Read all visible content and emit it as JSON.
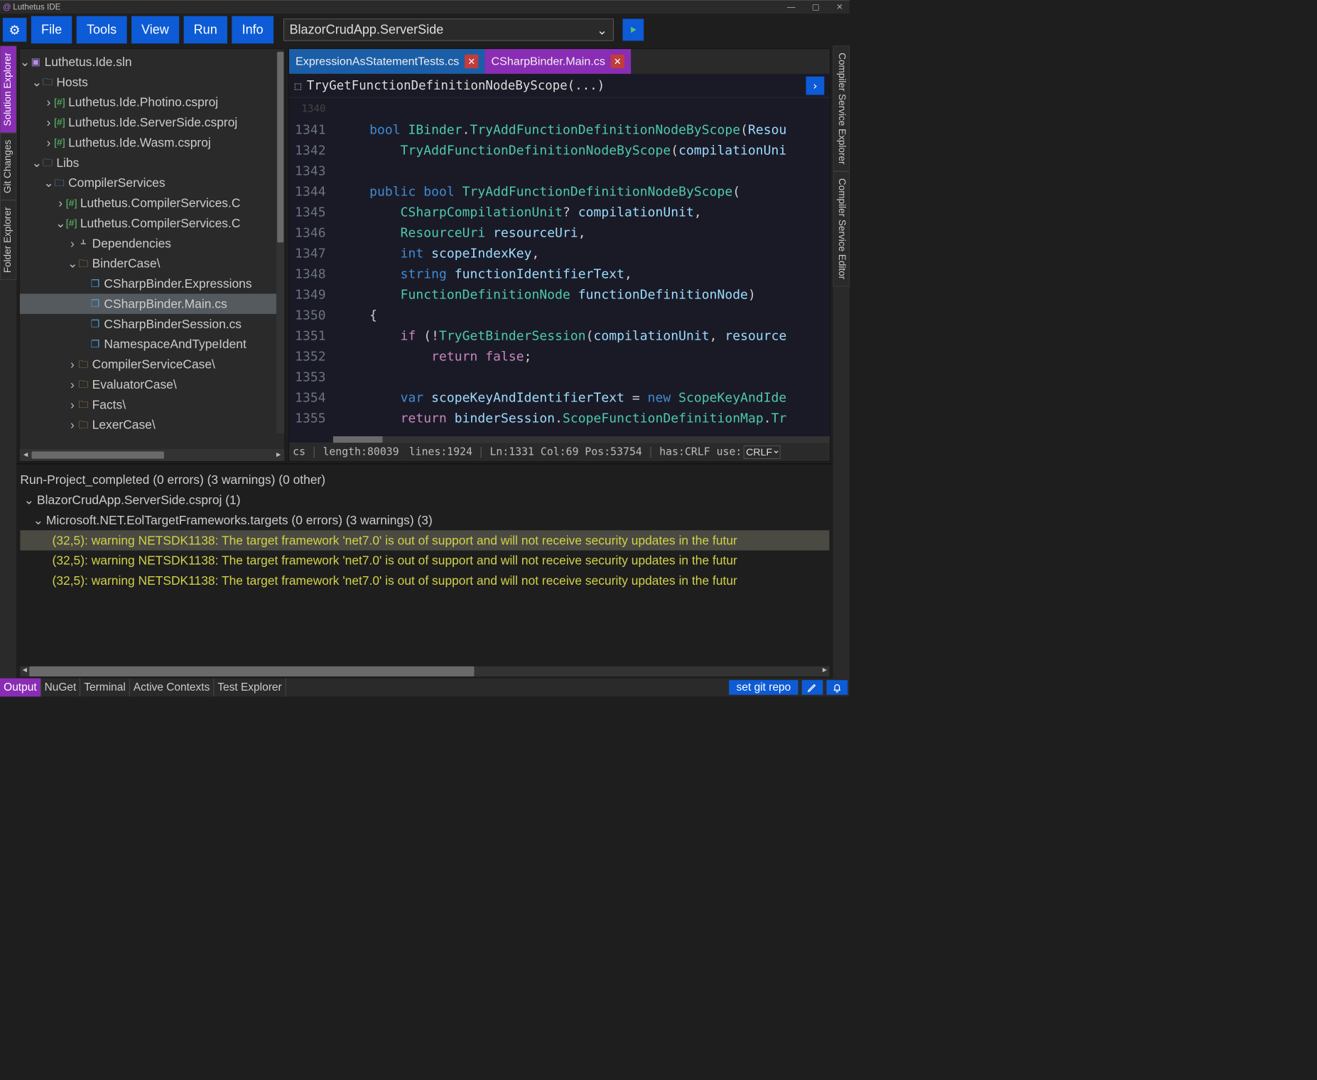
{
  "window": {
    "title": "Luthetus IDE"
  },
  "menu": {
    "items": [
      "File",
      "Tools",
      "View",
      "Run",
      "Info"
    ],
    "project_selected": "BlazorCrudApp.ServerSide"
  },
  "left_rail": [
    {
      "label": "Solution Explorer",
      "active": true
    },
    {
      "label": "Git Changes",
      "active": false
    },
    {
      "label": "Folder Explorer",
      "active": false
    }
  ],
  "right_rail": [
    {
      "label": "Compiler Service Explorer",
      "active": false
    },
    {
      "label": "Compiler Service Editor",
      "active": false
    }
  ],
  "tree": {
    "root": "Luthetus.Ide.sln",
    "hosts_label": "Hosts",
    "hosts": [
      "Luthetus.Ide.Photino.csproj",
      "Luthetus.Ide.ServerSide.csproj",
      "Luthetus.Ide.Wasm.csproj"
    ],
    "libs_label": "Libs",
    "compiler_services": "CompilerServices",
    "cs_proj_a": "Luthetus.CompilerServices.C",
    "cs_proj_b": "Luthetus.CompilerServices.C",
    "deps": "Dependencies",
    "binder_case": "BinderCase\\",
    "files": [
      "CSharpBinder.Expressions",
      "CSharpBinder.Main.cs",
      "CSharpBinderSession.cs",
      "NamespaceAndTypeIdent"
    ],
    "folders": [
      "CompilerServiceCase\\",
      "EvaluatorCase\\",
      "Facts\\",
      "LexerCase\\"
    ]
  },
  "editor": {
    "tabs": [
      {
        "label": "ExpressionAsStatementTests.cs",
        "active": false
      },
      {
        "label": "CSharpBinder.Main.cs",
        "active": true
      }
    ],
    "breadcrumb": "TryGetFunctionDefinitionNodeByScope(...)",
    "first_line": 1340,
    "lines": [
      "",
      "    bool IBinder.TryAddFunctionDefinitionNodeByScope(Resou",
      "        TryAddFunctionDefinitionNodeByScope(compilationUni",
      "",
      "    public bool TryAddFunctionDefinitionNodeByScope(",
      "        CSharpCompilationUnit? compilationUnit,",
      "        ResourceUri resourceUri,",
      "        int scopeIndexKey,",
      "        string functionIdentifierText,",
      "        FunctionDefinitionNode functionDefinitionNode)",
      "    {",
      "        if (!TryGetBinderSession(compilationUnit, resource",
      "            return false;",
      "",
      "        var scopeKeyAndIdentifierText = new ScopeKeyAndIde",
      "        return binderSession.ScopeFunctionDefinitionMap.Tr"
    ],
    "status": {
      "ext": "cs",
      "length_label": "length:80039",
      "lines_label": "lines:1924",
      "pos": "Ln:1331 Col:69  Pos:53754",
      "eol_label": "has:CRLF use:",
      "eol_value": "CRLF"
    }
  },
  "output": {
    "summary": "Run-Project_completed (0 errors) (3 warnings) (0 other)",
    "proj": "BlazorCrudApp.ServerSide.csproj (1)",
    "targets": "Microsoft.NET.EolTargetFrameworks.targets (0 errors) (3 warnings) (3)",
    "warnings": [
      "(32,5): warning NETSDK1138: The target framework 'net7.0' is out of support and will not receive security updates in the futur",
      "(32,5): warning NETSDK1138: The target framework 'net7.0' is out of support and will not receive security updates in the futur",
      "(32,5): warning NETSDK1138: The target framework 'net7.0' is out of support and will not receive security updates in the futur"
    ]
  },
  "bottom_tabs": [
    "Output",
    "NuGet",
    "Terminal",
    "Active Contexts",
    "Test Explorer"
  ],
  "bottom_actions": {
    "git": "set git repo"
  }
}
